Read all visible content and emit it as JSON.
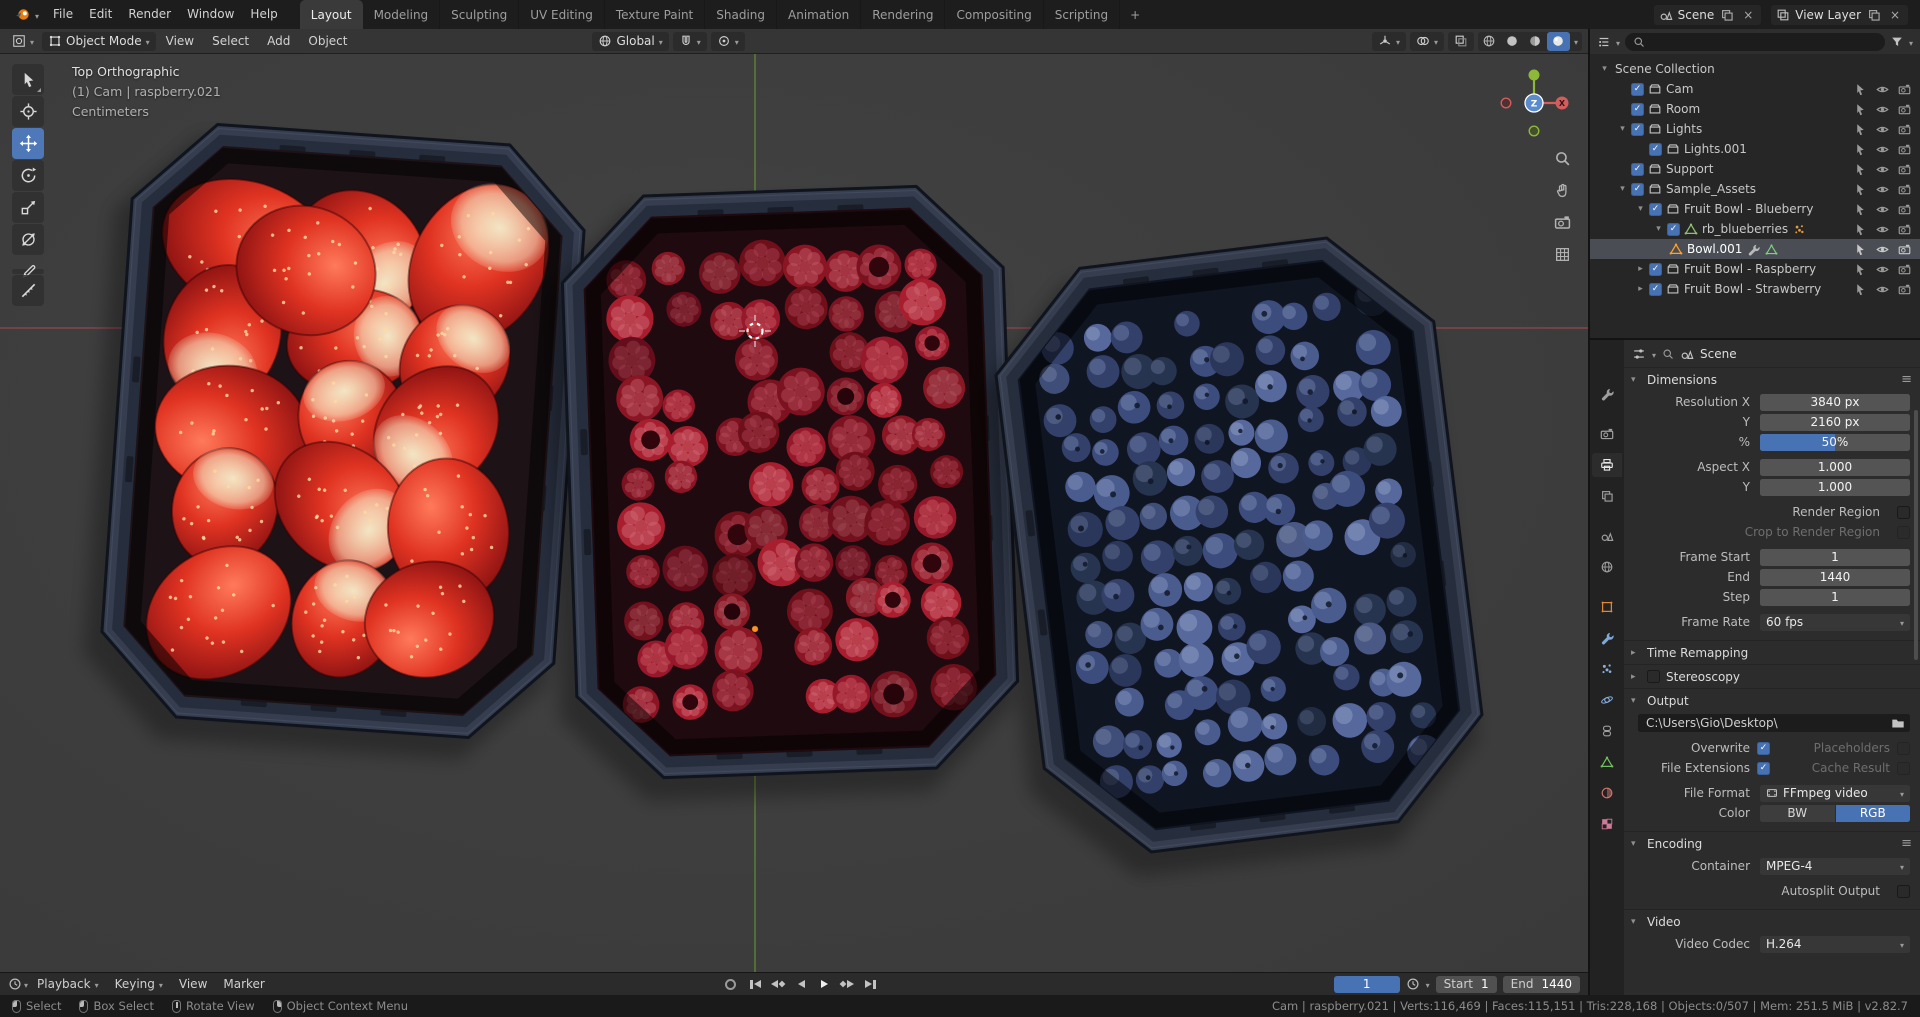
{
  "topbar": {
    "menus": [
      "File",
      "Edit",
      "Render",
      "Window",
      "Help"
    ],
    "workspaces": [
      "Layout",
      "Modeling",
      "Sculpting",
      "UV Editing",
      "Texture Paint",
      "Shading",
      "Animation",
      "Rendering",
      "Compositing",
      "Scripting"
    ],
    "add_workspace": "+",
    "scene_name": "Scene",
    "view_layer_name": "View Layer"
  },
  "viewport_header": {
    "mode": "Object Mode",
    "menus": [
      "View",
      "Select",
      "Add",
      "Object"
    ],
    "orientation": "Global"
  },
  "viewport": {
    "overlay_line1": "Top Orthographic",
    "overlay_line2": "(1) Cam | raspberry.021",
    "overlay_line3": "Centimeters",
    "gizmo_z": "Z",
    "gizmo_x": "X"
  },
  "outliner": {
    "search_placeholder": "",
    "rows": [
      {
        "label": "Scene Collection"
      },
      {
        "label": "Cam"
      },
      {
        "label": "Room"
      },
      {
        "label": "Lights"
      },
      {
        "label": "Lights.001"
      },
      {
        "label": "Support"
      },
      {
        "label": "Sample_Assets"
      },
      {
        "label": "Fruit Bowl - Blueberry"
      },
      {
        "label": "rb_blueberries"
      },
      {
        "label": "Bowl.001"
      },
      {
        "label": "Fruit Bowl - Raspberry"
      },
      {
        "label": "Fruit Bowl - Strawberry"
      }
    ]
  },
  "properties": {
    "breadcrumb": "Scene",
    "dimensions": {
      "title": "Dimensions",
      "resolution_x_label": "Resolution X",
      "resolution_x": "3840 px",
      "resolution_y_label": "Y",
      "resolution_y": "2160 px",
      "scale_label": "%",
      "scale": "50%",
      "aspect_x_label": "Aspect X",
      "aspect_x": "1.000",
      "aspect_y_label": "Y",
      "aspect_y": "1.000",
      "render_region_label": "Render Region",
      "crop_label": "Crop to Render Region",
      "frame_start_label": "Frame Start",
      "frame_start": "1",
      "frame_end_label": "End",
      "frame_end": "1440",
      "frame_step_label": "Step",
      "frame_step": "1",
      "frame_rate_label": "Frame Rate",
      "frame_rate": "60 fps"
    },
    "time_remapping_title": "Time Remapping",
    "stereoscopy_title": "Stereoscopy",
    "output": {
      "title": "Output",
      "path": "C:\\Users\\Gio\\Desktop\\",
      "overwrite_label": "Overwrite",
      "placeholders_label": "Placeholders",
      "file_extensions_label": "File Extensions",
      "cache_result_label": "Cache Result",
      "file_format_label": "File Format",
      "file_format": "FFmpeg video",
      "color_label": "Color",
      "color_bw": "BW",
      "color_rgb": "RGB"
    },
    "encoding": {
      "title": "Encoding",
      "container_label": "Container",
      "container": "MPEG-4",
      "autosplit_label": "Autosplit Output"
    },
    "video": {
      "title": "Video",
      "codec_label": "Video Codec",
      "codec": "H.264"
    }
  },
  "timeline": {
    "menus": [
      "Playback",
      "Keying",
      "View",
      "Marker"
    ],
    "current_frame": "1",
    "start_label": "Start",
    "start_value": "1",
    "end_label": "End",
    "end_value": "1440"
  },
  "statusbar": {
    "hint1": "Select",
    "hint2": "Box Select",
    "hint3": "Rotate View",
    "hint4": "Object Context Menu",
    "stats": "Cam | raspberry.021 | Verts:116,469 | Faces:115,151 | Tris:228,168 | Objects:0/507 | Mem: 251.5 MiB | v2.82.7"
  },
  "viewport_art": {
    "background": "#3d3d3d",
    "axis_x_color": "#b14a55",
    "axis_y_color": "#6ba12e",
    "crate_frame": "#353d4f",
    "crate_wall": "#262d3c",
    "crate_interior": [
      "#1d1216",
      "#1e0a0f",
      "#101522"
    ],
    "strawberry": {
      "body": [
        "#ff7a5a",
        "#e03322",
        "#7e0d10"
      ],
      "cap": "#f2ecca",
      "seed": "#ffd9a2"
    },
    "raspberry": [
      [
        "#6f0f1a",
        "#a8404e"
      ],
      [
        "#8c1524",
        "#c05a66"
      ],
      [
        "#a81e2e",
        "#d06873"
      ],
      [
        "#7c1120",
        "#b34a57"
      ],
      [
        "#97182a",
        "#c5545f"
      ]
    ],
    "blueberry": [
      [
        "#32406a",
        "#8f9fc7"
      ],
      [
        "#3c4c7c",
        "#9aabd1"
      ],
      [
        "#27344f",
        "#7c8cb0"
      ],
      [
        "#4a5c8e",
        "#a6b4d8"
      ],
      [
        "#56689c",
        "#b3c0de"
      ]
    ],
    "cursor3d": {
      "ring_white": "#ffffff",
      "ring_red": "#c9413f"
    },
    "origin_color": "#ff9226",
    "accent": "#4772b3"
  }
}
